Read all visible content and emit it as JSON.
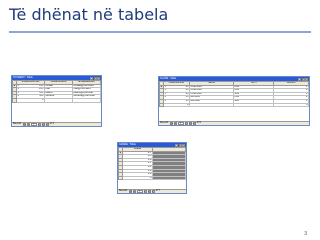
{
  "slide": {
    "title": "Të dhënat në tabela",
    "page_number": "3"
  },
  "student_window": {
    "title": "STUDENT : Table",
    "columns": [
      "StudentNumber",
      "StudentName",
      "EmailAddress"
    ],
    "rows": [
      [
        "100",
        "Cooke",
        "Cooke@Ourl.edu"
      ],
      [
        "200",
        "Lau",
        "Lau@Ourl.edu"
      ],
      [
        "300",
        "Harris",
        "Harris@Ourl.edu"
      ],
      [
        "400",
        "Greene",
        "Greene@Ourl.edu"
      ],
      [
        "0",
        "",
        ""
      ]
    ],
    "record_label": "Record:",
    "record_pos": "1",
    "record_total": "of 4"
  },
  "class_window": {
    "title": "CLASS : Table",
    "columns": [
      "ClassNumber",
      "Name",
      "Term",
      "Section"
    ],
    "rows": [
      [
        "10",
        "Chem101",
        "F04",
        "1"
      ],
      [
        "20",
        "Chem101",
        "F04",
        "2"
      ],
      [
        "30",
        "Chem101",
        "S05",
        "1"
      ],
      [
        "40",
        "Acct101",
        "F04",
        "1"
      ],
      [
        "50",
        "Acct102",
        "S05",
        "1"
      ],
      [
        "0",
        "",
        "",
        "0"
      ]
    ],
    "record_label": "Record:",
    "record_pos": "1",
    "record_total": "of 5"
  },
  "grade_window": {
    "title": "GRADE : Table",
    "columns": [
      "Grade"
    ],
    "rows": [
      [
        "3.7"
      ],
      [
        "3.5"
      ],
      [
        "3.0"
      ],
      [
        "3.7"
      ],
      [
        "3.1"
      ],
      [
        "3.9"
      ],
      [
        "2.8"
      ],
      [
        "0"
      ]
    ],
    "record_label": "Record:",
    "record_pos": "1",
    "record_total": "of 7"
  },
  "icons": {
    "close": "close-icon",
    "minimize": "minimize-icon",
    "maximize": "maximize-icon",
    "first": "first-record-icon",
    "prev": "previous-record-icon",
    "next": "next-record-icon",
    "last": "last-record-icon",
    "new": "new-record-icon"
  },
  "colors": {
    "title": "#1f3b7a",
    "titlebar": "#2a5bd7",
    "grid_header": "#ece9d8"
  }
}
